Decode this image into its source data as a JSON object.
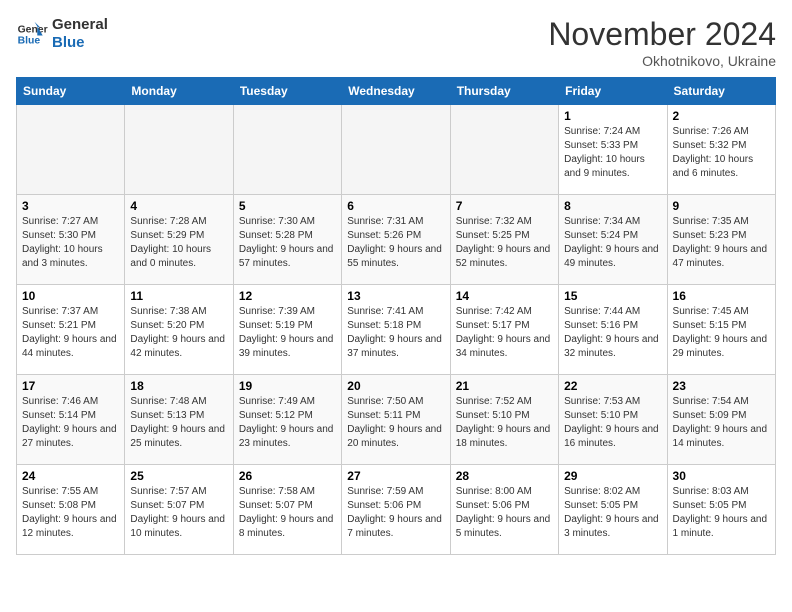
{
  "logo": {
    "line1": "General",
    "line2": "Blue"
  },
  "title": "November 2024",
  "location": "Okhotnikovo, Ukraine",
  "days_header": [
    "Sunday",
    "Monday",
    "Tuesday",
    "Wednesday",
    "Thursday",
    "Friday",
    "Saturday"
  ],
  "weeks": [
    [
      {
        "num": "",
        "info": ""
      },
      {
        "num": "",
        "info": ""
      },
      {
        "num": "",
        "info": ""
      },
      {
        "num": "",
        "info": ""
      },
      {
        "num": "",
        "info": ""
      },
      {
        "num": "1",
        "info": "Sunrise: 7:24 AM\nSunset: 5:33 PM\nDaylight: 10 hours and 9 minutes."
      },
      {
        "num": "2",
        "info": "Sunrise: 7:26 AM\nSunset: 5:32 PM\nDaylight: 10 hours and 6 minutes."
      }
    ],
    [
      {
        "num": "3",
        "info": "Sunrise: 7:27 AM\nSunset: 5:30 PM\nDaylight: 10 hours and 3 minutes."
      },
      {
        "num": "4",
        "info": "Sunrise: 7:28 AM\nSunset: 5:29 PM\nDaylight: 10 hours and 0 minutes."
      },
      {
        "num": "5",
        "info": "Sunrise: 7:30 AM\nSunset: 5:28 PM\nDaylight: 9 hours and 57 minutes."
      },
      {
        "num": "6",
        "info": "Sunrise: 7:31 AM\nSunset: 5:26 PM\nDaylight: 9 hours and 55 minutes."
      },
      {
        "num": "7",
        "info": "Sunrise: 7:32 AM\nSunset: 5:25 PM\nDaylight: 9 hours and 52 minutes."
      },
      {
        "num": "8",
        "info": "Sunrise: 7:34 AM\nSunset: 5:24 PM\nDaylight: 9 hours and 49 minutes."
      },
      {
        "num": "9",
        "info": "Sunrise: 7:35 AM\nSunset: 5:23 PM\nDaylight: 9 hours and 47 minutes."
      }
    ],
    [
      {
        "num": "10",
        "info": "Sunrise: 7:37 AM\nSunset: 5:21 PM\nDaylight: 9 hours and 44 minutes."
      },
      {
        "num": "11",
        "info": "Sunrise: 7:38 AM\nSunset: 5:20 PM\nDaylight: 9 hours and 42 minutes."
      },
      {
        "num": "12",
        "info": "Sunrise: 7:39 AM\nSunset: 5:19 PM\nDaylight: 9 hours and 39 minutes."
      },
      {
        "num": "13",
        "info": "Sunrise: 7:41 AM\nSunset: 5:18 PM\nDaylight: 9 hours and 37 minutes."
      },
      {
        "num": "14",
        "info": "Sunrise: 7:42 AM\nSunset: 5:17 PM\nDaylight: 9 hours and 34 minutes."
      },
      {
        "num": "15",
        "info": "Sunrise: 7:44 AM\nSunset: 5:16 PM\nDaylight: 9 hours and 32 minutes."
      },
      {
        "num": "16",
        "info": "Sunrise: 7:45 AM\nSunset: 5:15 PM\nDaylight: 9 hours and 29 minutes."
      }
    ],
    [
      {
        "num": "17",
        "info": "Sunrise: 7:46 AM\nSunset: 5:14 PM\nDaylight: 9 hours and 27 minutes."
      },
      {
        "num": "18",
        "info": "Sunrise: 7:48 AM\nSunset: 5:13 PM\nDaylight: 9 hours and 25 minutes."
      },
      {
        "num": "19",
        "info": "Sunrise: 7:49 AM\nSunset: 5:12 PM\nDaylight: 9 hours and 23 minutes."
      },
      {
        "num": "20",
        "info": "Sunrise: 7:50 AM\nSunset: 5:11 PM\nDaylight: 9 hours and 20 minutes."
      },
      {
        "num": "21",
        "info": "Sunrise: 7:52 AM\nSunset: 5:10 PM\nDaylight: 9 hours and 18 minutes."
      },
      {
        "num": "22",
        "info": "Sunrise: 7:53 AM\nSunset: 5:10 PM\nDaylight: 9 hours and 16 minutes."
      },
      {
        "num": "23",
        "info": "Sunrise: 7:54 AM\nSunset: 5:09 PM\nDaylight: 9 hours and 14 minutes."
      }
    ],
    [
      {
        "num": "24",
        "info": "Sunrise: 7:55 AM\nSunset: 5:08 PM\nDaylight: 9 hours and 12 minutes."
      },
      {
        "num": "25",
        "info": "Sunrise: 7:57 AM\nSunset: 5:07 PM\nDaylight: 9 hours and 10 minutes."
      },
      {
        "num": "26",
        "info": "Sunrise: 7:58 AM\nSunset: 5:07 PM\nDaylight: 9 hours and 8 minutes."
      },
      {
        "num": "27",
        "info": "Sunrise: 7:59 AM\nSunset: 5:06 PM\nDaylight: 9 hours and 7 minutes."
      },
      {
        "num": "28",
        "info": "Sunrise: 8:00 AM\nSunset: 5:06 PM\nDaylight: 9 hours and 5 minutes."
      },
      {
        "num": "29",
        "info": "Sunrise: 8:02 AM\nSunset: 5:05 PM\nDaylight: 9 hours and 3 minutes."
      },
      {
        "num": "30",
        "info": "Sunrise: 8:03 AM\nSunset: 5:05 PM\nDaylight: 9 hours and 1 minute."
      }
    ]
  ]
}
